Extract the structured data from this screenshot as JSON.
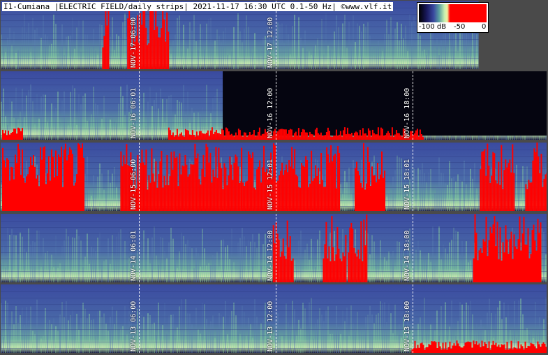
{
  "header": {
    "title": "I1-Cumiana |ELECTRIC FIELD/daily strips| 2021-11-17 16:30 UTC 0.1-50 Hz| ©www.vlf.it"
  },
  "legend": {
    "low": "-100 dB",
    "mid": "-50",
    "high": "0"
  },
  "chart_data": {
    "type": "heatmap",
    "title": "I1-Cumiana |ELECTRIC FIELD/daily strips| 2021-11-17 16:30 UTC 0.1-50 Hz| ©www.vlf.it",
    "colorbar_range_db": [
      -100,
      0
    ],
    "strips": [
      {
        "date": "NOV-17",
        "markers": [
          {
            "label": "NOV-17  06:00",
            "hour": 6
          },
          {
            "label": "NOV-17  12:00",
            "hour": 12
          }
        ]
      },
      {
        "date": "NOV-16",
        "markers": [
          {
            "label": "NOV-16  06:01",
            "hour": 6
          },
          {
            "label": "NOV-16  12:00",
            "hour": 12
          },
          {
            "label": "NOV-16  18:00",
            "hour": 18
          }
        ]
      },
      {
        "date": "NOV-15",
        "markers": [
          {
            "label": "NOV-15  06:00",
            "hour": 6
          },
          {
            "label": "NOV-15  12:01",
            "hour": 12
          },
          {
            "label": "NOV-15  18:01",
            "hour": 18
          }
        ]
      },
      {
        "date": "NOV-14",
        "markers": [
          {
            "label": "NOV-14  06:01",
            "hour": 6
          },
          {
            "label": "NOV-14  12:00",
            "hour": 12
          },
          {
            "label": "NOV-14  18:00",
            "hour": 18
          }
        ]
      },
      {
        "date": "NOV-13",
        "markers": [
          {
            "label": "NOV-13  06:00",
            "hour": 6
          },
          {
            "label": "NOV-13  12:00",
            "hour": 12
          },
          {
            "label": "NOV-13  18:00",
            "hour": 18
          }
        ]
      }
    ]
  }
}
